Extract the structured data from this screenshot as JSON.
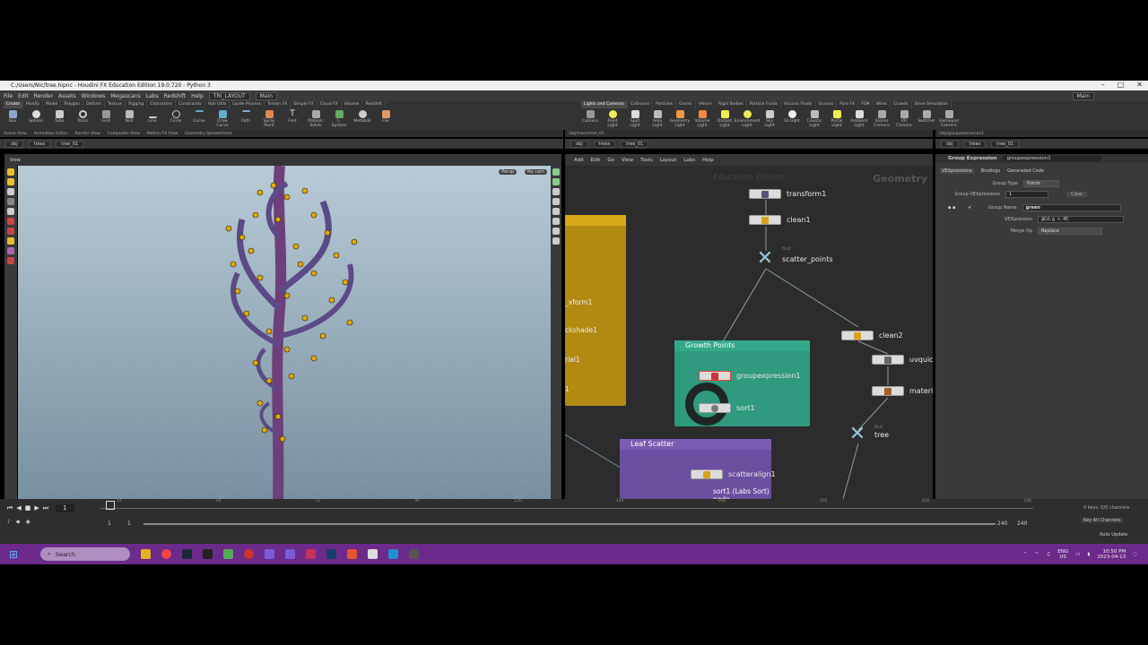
{
  "window": {
    "title": "C:/Users/Nic/tree.hipnc - Houdini FX Education Edition 19.0.720 - Python 3"
  },
  "menu": {
    "items": [
      "File",
      "Edit",
      "Render",
      "Assets",
      "Windows",
      "Megascans",
      "Labs",
      "Redshift",
      "Help"
    ],
    "desktop": "TRI_LAYOUT",
    "main": "Main",
    "right": "Main"
  },
  "shelf_left": {
    "tabs": [
      "Create",
      "Modify",
      "Model",
      "Polygon",
      "Deform",
      "Texture",
      "Rigging",
      "Characters",
      "Constraints",
      "Hair Utils",
      "Guide Process",
      "Terrain FX",
      "Simple FX",
      "Cloud FX",
      "Volume",
      "Redshift"
    ],
    "tools": [
      "Box",
      "Sphere",
      "Tube",
      "Torus",
      "Grid",
      "Null",
      "Line",
      "Circle",
      "Curve",
      "Draw Curve",
      "Path",
      "Spray Paint",
      "Font",
      "Platonic Solids",
      "L-System",
      "Metaball",
      "File"
    ]
  },
  "shelf_right": {
    "tabs": [
      "Lights and Cameras",
      "Collisions",
      "Particles",
      "Grains",
      "Vellum",
      "Rigid Bodies",
      "Particle Fluids",
      "Viscous Fluids",
      "Oceans",
      "Pyro FX",
      "FEM",
      "Wires",
      "Crowds",
      "Drive Simulation"
    ],
    "tools": [
      "Camera",
      "Point Light",
      "Spot Light",
      "Area Light",
      "Geometry Light",
      "Volume Light",
      "Distant Light",
      "Environment Light",
      "Sky Light",
      "GI Light",
      "Caustic Light",
      "Portal Light",
      "Ambient Light",
      "Stereo Camera",
      "VR Camera",
      "Switcher",
      "Gamepad Camera"
    ]
  },
  "left_pane": {
    "tabs": [
      "Scene View",
      "Animation Editor",
      "Render View",
      "Composite View",
      "Motion FX View",
      "Geometry Spreadsheet"
    ],
    "path": [
      "obj",
      "trees",
      "tree_01"
    ],
    "view_label": "View",
    "persp": "Persp",
    "cam": "No cam"
  },
  "mid_pane": {
    "path_label": "/obj/trees/tree_01",
    "path": [
      "obj",
      "trees",
      "tree_01"
    ],
    "menu": [
      "Add",
      "Edit",
      "Go",
      "View",
      "Tools",
      "Layout",
      "Labs",
      "Help"
    ],
    "watermark": "Education Edition",
    "context": "Geometry"
  },
  "nodes": {
    "transform": "transform1",
    "clean": "clean1",
    "null_flag": "Null",
    "scatter": "scatter_points",
    "clean2": "clean2",
    "uvquick": "uvquick",
    "material": "materia",
    "tree_null_flag": "Null",
    "tree": "tree",
    "groupexpr": "groupexpression1",
    "sort": "sort1",
    "scatteralign": "scatteralign1",
    "tooltip": "sort1 (Labs Sort) node"
  },
  "boxes": {
    "growth": "Growth Points",
    "leaf": "Leaf Scatter",
    "yellow_labels": [
      "_xform1",
      "ckshade1",
      "rial1",
      "1"
    ]
  },
  "params": {
    "tab_path": "/obj/groupexpression1",
    "node_type": "Group Expression",
    "node_name": "groupexpression1",
    "path": [
      "obj",
      "trees",
      "tree_01"
    ],
    "tabs": [
      "VEXpressions",
      "Bindings",
      "Generated Code"
    ],
    "group_type_label": "Group Type",
    "group_type": "Points",
    "group_vex_label": "Group VEXpressions",
    "group_vex": "1",
    "clear": "Clear",
    "group_name_label": "Group Name",
    "group_name": "green",
    "vex_label": "VEXpression",
    "vex": "@Cd.g >.45",
    "merge_label": "Merge Op",
    "merge": "Replace"
  },
  "timeline": {
    "frame": "1",
    "start": "1",
    "start2": "1",
    "end": "240",
    "end2": "240",
    "ticks": [
      "1",
      "24",
      "48",
      "72",
      "96",
      "120",
      "144",
      "168",
      "192",
      "216",
      "240"
    ],
    "keys": "0 keys, 0/0 channels",
    "keyall": "Key All Channels",
    "auto": "Auto Update"
  },
  "taskbar": {
    "search": "Search",
    "lang": "ENG",
    "region": "US",
    "time": "10:50 PM",
    "date": "2023-04-13"
  }
}
